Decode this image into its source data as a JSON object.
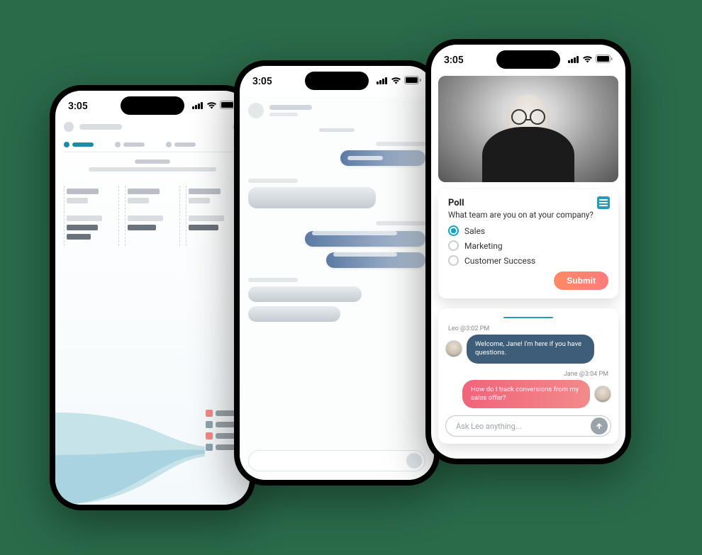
{
  "status_time": "3:05",
  "phone1": {
    "tabs": [
      {
        "active": true
      },
      {
        "active": false
      },
      {
        "active": false
      }
    ],
    "legend_colors": [
      "#f38a8a",
      "#8fa5b0",
      "#f38a8a",
      "#8fa5b0"
    ]
  },
  "phone2": {
    "messages": [
      {
        "side": "in",
        "width": 110
      },
      {
        "side": "out",
        "width": 170,
        "big": true
      },
      {
        "side": "in",
        "width": 150
      },
      {
        "side": "in",
        "width": 130
      },
      {
        "side": "out",
        "width": 150
      },
      {
        "side": "out",
        "width": 130
      }
    ]
  },
  "phone3": {
    "poll": {
      "title": "Poll",
      "question": "What team are you on at your company?",
      "options": [
        {
          "label": "Sales",
          "selected": true
        },
        {
          "label": "Marketing",
          "selected": false
        },
        {
          "label": "Customer Success",
          "selected": false
        }
      ],
      "submit_label": "Submit"
    },
    "chat": {
      "msg1_meta": "Leo @3:02 PM",
      "msg1_text": "Welcome, Jane! I'm here if you have questions.",
      "msg2_meta": "Jane @3:04 PM",
      "msg2_text": "How do I track conversions from my sales offer?",
      "input_placeholder": "Ask Leo anything..."
    }
  }
}
